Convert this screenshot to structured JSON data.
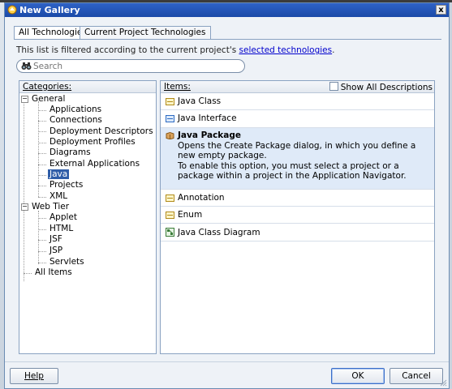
{
  "window": {
    "title": "New Gallery",
    "close_label": "x"
  },
  "tabs": [
    {
      "label": "All Technologies",
      "active": true
    },
    {
      "label": "Current Project Technologies",
      "active": false
    }
  ],
  "filter_note": {
    "text": "This list is filtered according to the current project's ",
    "link": "selected technologies",
    "suffix": "."
  },
  "search": {
    "placeholder": "Search",
    "value": ""
  },
  "categories": {
    "header": "Categories:",
    "tree": [
      {
        "label": "General",
        "level": 0,
        "expanded": true,
        "selected": false
      },
      {
        "label": "Applications",
        "level": 1,
        "selected": false
      },
      {
        "label": "Connections",
        "level": 1,
        "selected": false
      },
      {
        "label": "Deployment Descriptors",
        "level": 1,
        "selected": false
      },
      {
        "label": "Deployment Profiles",
        "level": 1,
        "selected": false
      },
      {
        "label": "Diagrams",
        "level": 1,
        "selected": false
      },
      {
        "label": "External Applications",
        "level": 1,
        "selected": false
      },
      {
        "label": "Java",
        "level": 1,
        "selected": true
      },
      {
        "label": "Projects",
        "level": 1,
        "selected": false
      },
      {
        "label": "XML",
        "level": 1,
        "selected": false
      },
      {
        "label": "Web Tier",
        "level": 0,
        "expanded": true,
        "selected": false
      },
      {
        "label": "Applet",
        "level": 1,
        "selected": false
      },
      {
        "label": "HTML",
        "level": 1,
        "selected": false
      },
      {
        "label": "JSF",
        "level": 1,
        "selected": false
      },
      {
        "label": "JSP",
        "level": 1,
        "selected": false
      },
      {
        "label": "Servlets",
        "level": 1,
        "selected": false
      },
      {
        "label": "All Items",
        "level": 0,
        "selected": false
      }
    ]
  },
  "items": {
    "header": "Items:",
    "show_all_label": "Show All Descriptions",
    "show_all_checked": false,
    "list": [
      {
        "label": "Java Class",
        "icon": "java-class-icon"
      },
      {
        "label": "Java Interface",
        "icon": "java-interface-icon"
      },
      {
        "label": "Java Package",
        "icon": "java-package-icon",
        "selected": true,
        "description1": "Opens the Create Package dialog, in which you define a new empty package.",
        "description2": "To enable this option, you must select a project or a package within a project in the Application Navigator."
      },
      {
        "label": "Annotation",
        "icon": "annotation-icon"
      },
      {
        "label": "Enum",
        "icon": "enum-icon"
      },
      {
        "label": "Java Class Diagram",
        "icon": "class-diagram-icon"
      }
    ]
  },
  "buttons": {
    "help": "Help",
    "ok": "OK",
    "cancel": "Cancel"
  }
}
